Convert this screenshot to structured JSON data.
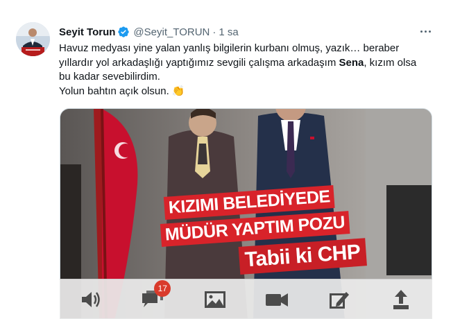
{
  "tweet": {
    "display_name": "Seyit Torun",
    "handle": "@Seyit_TORUN",
    "separator": "·",
    "time": "1 sa",
    "verified_icon": "verified-badge-icon",
    "more_icon": "more-options-icon",
    "text": {
      "line1": "Havuz medyası yine yalan yanlış bilgilerin kurbanı olmuş, yazık… beraber",
      "line2_before": "yıllardır yol arkadaşlığı yaptığımız sevgili çalışma arkadaşım ",
      "line2_bold": "Sena",
      "line2_after": ", kızım olsa",
      "line3": "bu kadar sevebilirdim.",
      "line4": "Yolun bahtın açık olsun.",
      "emoji": "👏"
    }
  },
  "media": {
    "overlay_line1": "KIZIMI BELEDİYEDE",
    "overlay_line2": "MÜDÜR YAPTIM POZU",
    "overlay_line3": "Tabii ki CHP",
    "colors": {
      "banner": "#d8232a",
      "flag": "#c8102e"
    }
  },
  "toolbar": {
    "items": [
      {
        "icon": "speaker-icon"
      },
      {
        "icon": "comments-icon",
        "badge": "17"
      },
      {
        "icon": "image-icon"
      },
      {
        "icon": "video-camera-icon"
      },
      {
        "icon": "edit-icon"
      },
      {
        "icon": "share-icon"
      }
    ]
  }
}
